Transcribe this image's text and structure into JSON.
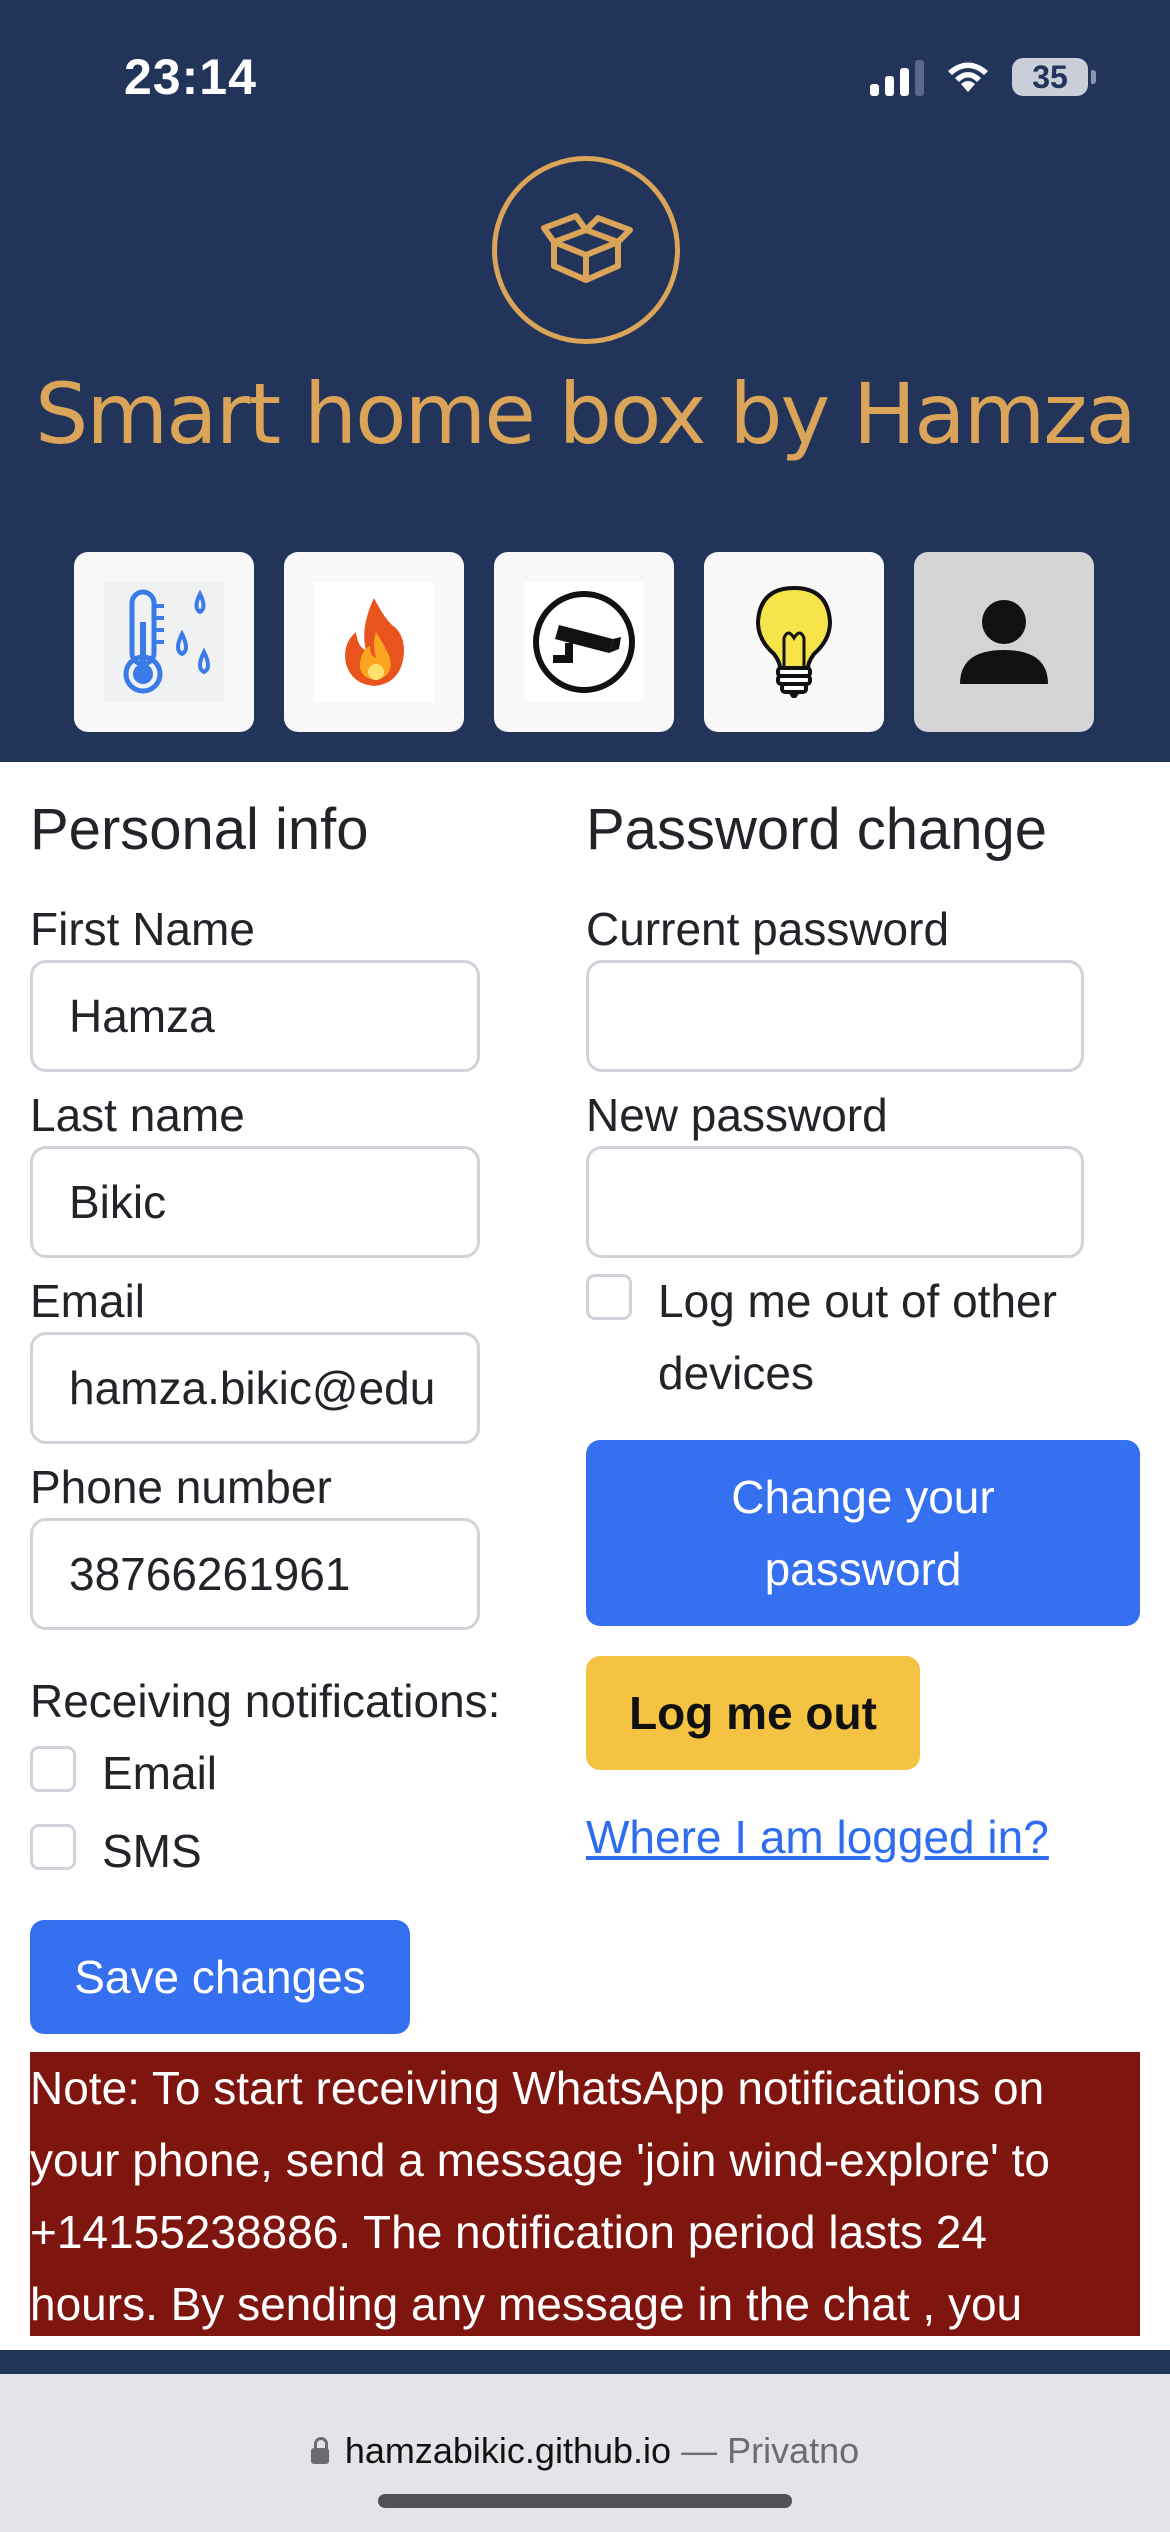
{
  "status": {
    "time": "23:14",
    "battery": "35"
  },
  "header": {
    "title": "Smart home box by Hamza"
  },
  "nav": [
    {
      "name": "temperature-humidity",
      "icon": "thermometer-droplets-icon"
    },
    {
      "name": "fire",
      "icon": "flame-icon"
    },
    {
      "name": "camera",
      "icon": "security-camera-icon"
    },
    {
      "name": "light",
      "icon": "light-bulb-icon"
    },
    {
      "name": "profile",
      "icon": "user-icon",
      "active": true
    }
  ],
  "personal": {
    "title": "Personal info",
    "first_name_label": "First Name",
    "first_name_value": "Hamza",
    "last_name_label": "Last name",
    "last_name_value": "Bikic",
    "email_label": "Email",
    "email_value": "hamza.bikic@edu",
    "phone_label": "Phone number",
    "phone_value": "38766261961",
    "notifications_label": "Receiving notifications:",
    "notify_email": "Email",
    "notify_sms": "SMS",
    "save_button": "Save changes"
  },
  "password": {
    "title": "Password change",
    "current_label": "Current password",
    "new_label": "New password",
    "logout_others_line1": "Log me out of other",
    "logout_others_line2": "devices",
    "change_button_line1": "Change your",
    "change_button_line2": "password",
    "logout_button": "Log me out",
    "where_link": "Where I am logged in?"
  },
  "note": {
    "line1": "Note: To start receiving WhatsApp notifications on",
    "line2": "your phone, send a message 'join wind-explore' to",
    "line3": "+14155238886. The notification period lasts 24",
    "line4": "hours. By sending any message in the chat , you"
  },
  "browser": {
    "domain": "hamzabikic.github.io",
    "suffix": "— Privatno"
  },
  "colors": {
    "header_bg": "#22345a",
    "accent_gold": "#daa558",
    "primary": "#3570f0",
    "warning": "#f5c342",
    "note_bg": "#7e150f"
  }
}
